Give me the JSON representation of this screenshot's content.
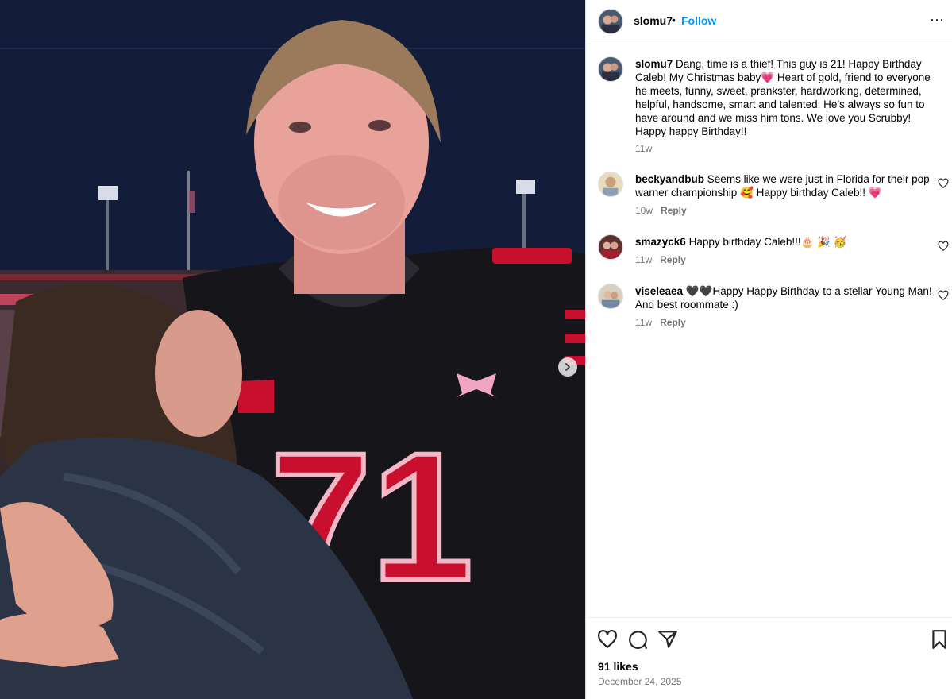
{
  "post": {
    "author": "slomu7",
    "separator": "•",
    "follow_label": "Follow",
    "more_icon": "more-horizontal-icon",
    "more_label": "⋯",
    "caption": {
      "username": "slomu7",
      "text": "Dang, time is a thief! This guy is 21! Happy Birthday Caleb! My Christmas baby💗 Heart of gold, friend to everyone he meets, funny, sweet, prankster, hardworking, determined, helpful, handsome, smart and talented. He’s always so fun to have around and we miss him tons. We love you Scrubby! Happy happy Birthday!!",
      "time": "11w"
    },
    "comments": [
      {
        "username": "beckyandbub",
        "text": "Seems like we were just in Florida for their pop warner championship 🥰 Happy birthday Caleb!! 💗",
        "time": "10w",
        "reply_label": "Reply"
      },
      {
        "username": "smazyck6",
        "text": "Happy birthday Caleb!!!🎂 🎉 🥳",
        "time": "11w",
        "reply_label": "Reply"
      },
      {
        "username": "viseleaea",
        "text": "🖤🖤Happy Happy Birthday to a stellar Young Man! And best roommate :)",
        "time": "11w",
        "reply_label": "Reply"
      }
    ],
    "likes": "91 likes",
    "date": "December 24, 2025",
    "photo": {
      "jersey_number": "71"
    }
  },
  "colors": {
    "link_blue": "#0095f6",
    "meta_gray": "#737373",
    "jersey_red": "#c8102e",
    "jersey_black": "#151518"
  }
}
